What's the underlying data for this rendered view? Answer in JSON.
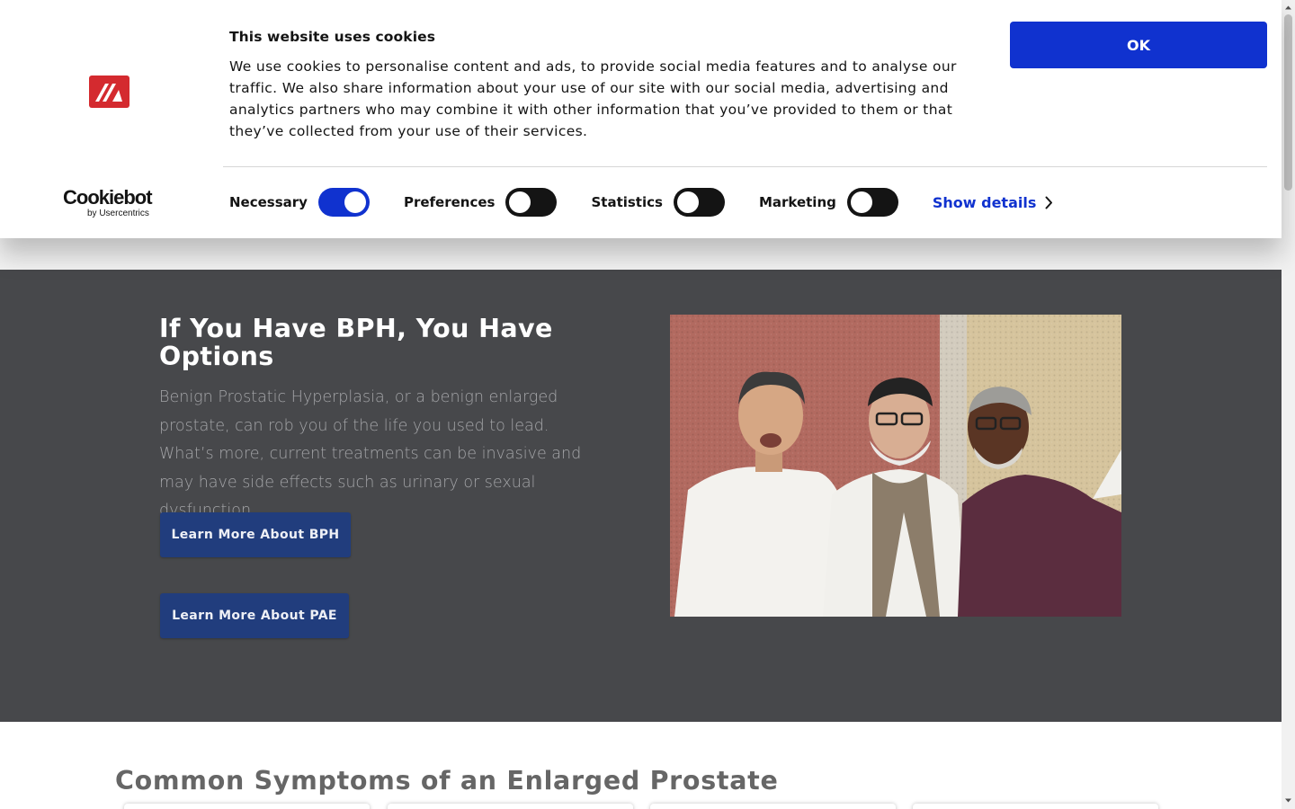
{
  "cookie_banner": {
    "title": "This website uses cookies",
    "text": "We use cookies to personalise content and ads, to provide social media features and to analyse our traffic. We also share information about your use of our site with our social media, advertising and analytics partners who may combine it with other information that you’ve provided to them or that they’ve collected from your use of their services.",
    "ok_label": "OK",
    "brand": "Cookiebot",
    "brand_sub": "by Usercentrics",
    "consents": [
      {
        "label": "Necessary",
        "enabled": true
      },
      {
        "label": "Preferences",
        "enabled": false
      },
      {
        "label": "Statistics",
        "enabled": false
      },
      {
        "label": "Marketing",
        "enabled": false
      }
    ],
    "show_details_label": "Show details",
    "accent_color": "#1032cf"
  },
  "hero": {
    "title": "If You Have BPH, You Have Options",
    "text": "Benign Prostatic Hyperplasia, or a benign enlarged prostate, can rob you of the life you used to lead. What’s more, current treatments can be invasive and may have side effects such as urinary or sexual dysfunction.",
    "buttons": [
      {
        "label": "Learn More About BPH"
      },
      {
        "label": "Learn More About PAE"
      }
    ],
    "background_color": "#47484b",
    "button_color": "#213d7d"
  },
  "symptoms": {
    "title": "Common Symptoms of an Enlarged Prostate"
  },
  "icons": {
    "site_logo": "site-logo-icon",
    "show_details_chevron": "chevron-right-icon"
  }
}
